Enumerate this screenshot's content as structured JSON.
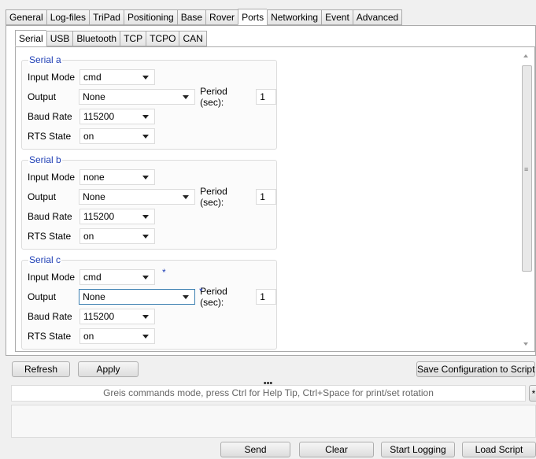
{
  "main_tabs": [
    "General",
    "Log-files",
    "TriPad",
    "Positioning",
    "Base",
    "Rover",
    "Ports",
    "Networking",
    "Event",
    "Advanced"
  ],
  "main_tab_active": "Ports",
  "sub_tabs": [
    "Serial",
    "USB",
    "Bluetooth",
    "TCP",
    "TCPO",
    "CAN"
  ],
  "sub_tab_active": "Serial",
  "labels": {
    "input_mode": "Input Mode",
    "output": "Output",
    "baud_rate": "Baud Rate",
    "rts_state": "RTS State",
    "period": "Period (sec):"
  },
  "groups": [
    {
      "title": "Serial a",
      "input_mode": "cmd",
      "output": "None",
      "period": "1",
      "baud_rate": "115200",
      "rts_state": "on",
      "input_modified": "",
      "output_modified": ""
    },
    {
      "title": "Serial b",
      "input_mode": "none",
      "output": "None",
      "period": "1",
      "baud_rate": "115200",
      "rts_state": "on",
      "input_modified": "",
      "output_modified": ""
    },
    {
      "title": "Serial c",
      "input_mode": "cmd",
      "output": "None",
      "period": "1",
      "baud_rate": "115200",
      "rts_state": "on",
      "input_modified": "*",
      "output_modified": "*"
    }
  ],
  "buttons": {
    "refresh": "Refresh",
    "apply": "Apply",
    "save_script": "Save Configuration to Script",
    "send": "Send",
    "clear": "Clear",
    "start_logging": "Start Logging",
    "load_script": "Load Script"
  },
  "splitter_handle": "•••",
  "command_line": {
    "placeholder": "Greis commands mode, press Ctrl for Help Tip, Ctrl+Space for print/set rotation"
  },
  "icons": {
    "dropdown": "chevron-down-icon",
    "scroll_up": "arrow-up-icon",
    "scroll_down": "arrow-down-icon",
    "scroll_grip": "grip-icon"
  },
  "colors": {
    "group_title": "#1f3fb5",
    "focus_border": "#3c7fb1"
  }
}
